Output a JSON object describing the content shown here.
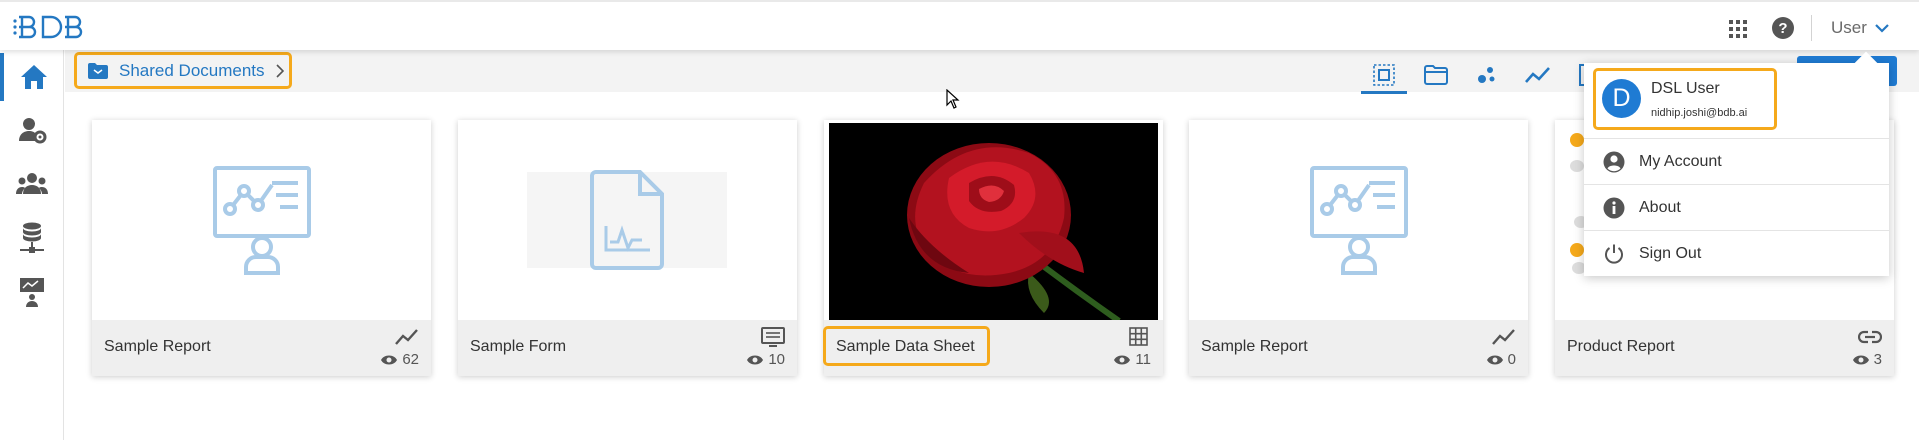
{
  "header": {
    "user_label": "User"
  },
  "sidebar": {
    "items": [
      {
        "icon": "home-icon",
        "active": true
      },
      {
        "icon": "user-settings-icon"
      },
      {
        "icon": "users-group-icon"
      },
      {
        "icon": "database-icon"
      },
      {
        "icon": "presentation-icon"
      }
    ]
  },
  "breadcrumb": {
    "label": "Shared Documents"
  },
  "view_filters": [
    "all-icon",
    "folder-icon",
    "scatter-icon",
    "trend-icon"
  ],
  "cards": [
    {
      "name": "Sample Report",
      "views": "62",
      "type_icon": "trend-icon"
    },
    {
      "name": "Sample Form",
      "views": "10",
      "type_icon": "form-icon"
    },
    {
      "name": "Sample Data Sheet",
      "views": "11",
      "type_icon": "grid-icon"
    },
    {
      "name": "Sample Report",
      "views": "0",
      "type_icon": "trend-icon"
    },
    {
      "name": "Product Report",
      "views": "3",
      "type_icon": "link-icon"
    }
  ],
  "user_dropdown": {
    "avatar_letter": "D",
    "name": "DSL User",
    "email": "nidhip.joshi@bdb.ai",
    "items": [
      {
        "label": "My Account",
        "icon": "account-icon"
      },
      {
        "label": "About",
        "icon": "info-icon"
      },
      {
        "label": "Sign Out",
        "icon": "power-icon"
      }
    ]
  },
  "colors": {
    "accent": "#2478c2",
    "highlight": "#f5a91b",
    "icon_light": "#a9cbe8"
  }
}
